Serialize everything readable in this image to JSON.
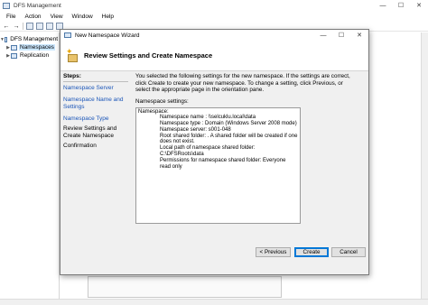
{
  "window": {
    "title": "DFS Management",
    "controls": {
      "minimize": "—",
      "maximize": "☐",
      "close": "✕"
    }
  },
  "menu": [
    "File",
    "Action",
    "View",
    "Window",
    "Help"
  ],
  "tree": {
    "root": "DFS Management",
    "items": [
      {
        "label": "Namespaces",
        "selected": true
      },
      {
        "label": "Replication",
        "selected": false
      }
    ]
  },
  "dialog": {
    "title": "New Namespace Wizard",
    "controls": {
      "minimize": "—",
      "maximize": "☐",
      "close": "✕"
    },
    "heading": "Review Settings and Create Namespace",
    "steps_title": "Steps:",
    "steps": [
      {
        "label": "Namespace Server",
        "state": "link"
      },
      {
        "label": "Namespace Name and Settings",
        "state": "link"
      },
      {
        "label": "Namespace Type",
        "state": "link"
      },
      {
        "label": "Review Settings and Create Namespace",
        "state": "current"
      },
      {
        "label": "Confirmation",
        "state": "plain"
      }
    ],
    "intro": "You selected the following settings for the new namespace. If the settings are correct, click Create to create your new namespace. To change a setting, click Previous, or select the appropriate page in the orientation pane.",
    "settings_label": "Namespace settings:",
    "settings_heading": "Namespace:",
    "settings_lines": [
      "Namespace name : \\\\selcuklu.local\\data",
      "Namespace type : Domain (Windows Server 2008 mode)",
      "Namespace server: s001-048",
      "Root shared folder: . A shared folder will be created if one does not exist.",
      "Local path of namespace shared folder: C:\\DFSRoots\\data",
      "Permissions for namespace shared folder: Everyone read only"
    ],
    "buttons": {
      "previous": "< Previous",
      "create": "Create",
      "cancel": "Cancel"
    }
  }
}
